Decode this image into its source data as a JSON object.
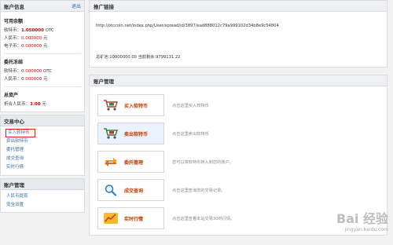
{
  "sidebar": {
    "account_panel": {
      "title": "账户信息",
      "logout": "退出",
      "available": {
        "title": "可用余额",
        "rows": [
          {
            "label": "软特币：",
            "value": "1.050000",
            "unit": "OTC"
          },
          {
            "label": "人民币：",
            "value": "0.000000",
            "unit": "元"
          },
          {
            "label": "电子币：",
            "value": "0.000000",
            "unit": "元"
          }
        ]
      },
      "frozen": {
        "title": "委托冻结",
        "rows": [
          {
            "label": "软特币：",
            "value": "0.000000",
            "unit": "OTC"
          },
          {
            "label": "人民币：",
            "value": "0.000000",
            "unit": "元"
          }
        ]
      },
      "total": {
        "title": "总资产",
        "label": "折合人民币：",
        "value": "3.00",
        "unit": "元"
      }
    },
    "trade_center": {
      "title": "交易中心",
      "items": [
        "买入软特币",
        "卖出软特币",
        "委托管理",
        "成交查询",
        "实时行情"
      ]
    },
    "account_mgmt": {
      "title": "账户管理",
      "items": [
        "人民币提现",
        "安全设置"
      ]
    }
  },
  "main": {
    "promo": {
      "title": "推广链接",
      "link": "http://otccoin.net/index.php/User/spread/id/3897/ead888012c79a999102d34b8e9c54804",
      "stats": "总矿池:10000000.00 当前剩余:9799131.22"
    },
    "management": {
      "title": "账户管理",
      "actions": [
        {
          "label": "买入软特币",
          "desc": "点击这里买入软特币",
          "icon": "cart-buy-icon"
        },
        {
          "label": "卖出软特币",
          "desc": "点击这里卖出软特币",
          "icon": "cart-sell-icon"
        },
        {
          "label": "委托管理",
          "desc": "您可以将软特币转入到您的账户。",
          "icon": "transfer-icon"
        },
        {
          "label": "成交查询",
          "desc": "点击这里查询您的交易记录。",
          "icon": "magnifier-icon"
        },
        {
          "label": "实时行情",
          "desc": "点击这里查看本站交易30时行情。",
          "icon": "chart-icon"
        }
      ]
    }
  },
  "watermark": {
    "brand": "Bai 经验",
    "domain": "jingyan.baidu.com"
  },
  "colors": {
    "accent_red": "#d40000",
    "link_blue": "#3a6ea5",
    "highlight_border": "#e21b1b"
  }
}
